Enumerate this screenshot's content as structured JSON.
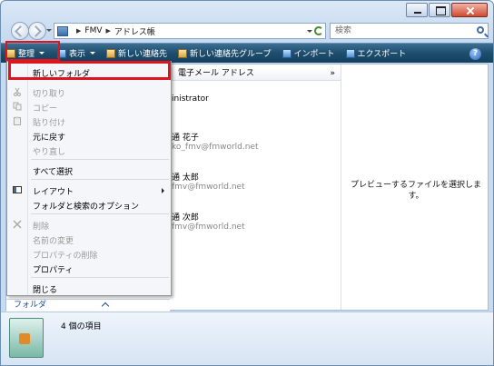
{
  "address": {
    "segments": [
      "FMV",
      "アドレス帳"
    ]
  },
  "search": {
    "placeholder": "検索"
  },
  "toolbar": {
    "organize": "整理",
    "view": "表示",
    "new_contact": "新しい連絡先",
    "new_group": "新しい連絡先グループ",
    "import": "インポート",
    "export": "エクスポート",
    "help": "?"
  },
  "columns": {
    "email_header": "電子メール アドレス",
    "more": "»"
  },
  "contacts": [
    {
      "name": "inistrator",
      "email": ""
    },
    {
      "name": "通 花子",
      "email": "ko_fmv@fmworld.net"
    },
    {
      "name": "通 太郎",
      "email": "fmv@fmworld.net"
    },
    {
      "name": "通 次郎",
      "email": "fmv@fmworld.net"
    }
  ],
  "preview": {
    "message": "プレビューするファイルを選択します。"
  },
  "folder_pane": {
    "label": "フォルダ"
  },
  "details": {
    "count": "4 個の項目"
  },
  "menu": {
    "items": [
      {
        "label": "新しいフォルダ",
        "enabled": true
      },
      {
        "label": "切り取り",
        "enabled": false,
        "icon": "scissors-icon"
      },
      {
        "label": "コピー",
        "enabled": false,
        "icon": "copy-icon"
      },
      {
        "label": "貼り付け",
        "enabled": false,
        "icon": "paste-icon"
      },
      {
        "label": "元に戻す",
        "enabled": true
      },
      {
        "label": "やり直し",
        "enabled": false
      },
      {
        "label": "すべて選択",
        "enabled": true
      },
      {
        "label": "レイアウト",
        "enabled": true,
        "icon": "layout-icon",
        "submenu": true
      },
      {
        "label": "フォルダと検索のオプション",
        "enabled": true
      },
      {
        "label": "削除",
        "enabled": false,
        "icon": "delete-icon"
      },
      {
        "label": "名前の変更",
        "enabled": false
      },
      {
        "label": "プロパティの削除",
        "enabled": false
      },
      {
        "label": "プロパティ",
        "enabled": true
      },
      {
        "label": "閉じる",
        "enabled": true
      }
    ]
  },
  "colors": {
    "toolbar": "#1e4e6e",
    "highlight": "#e0141e",
    "disabled_text": "#9a9a9a"
  }
}
